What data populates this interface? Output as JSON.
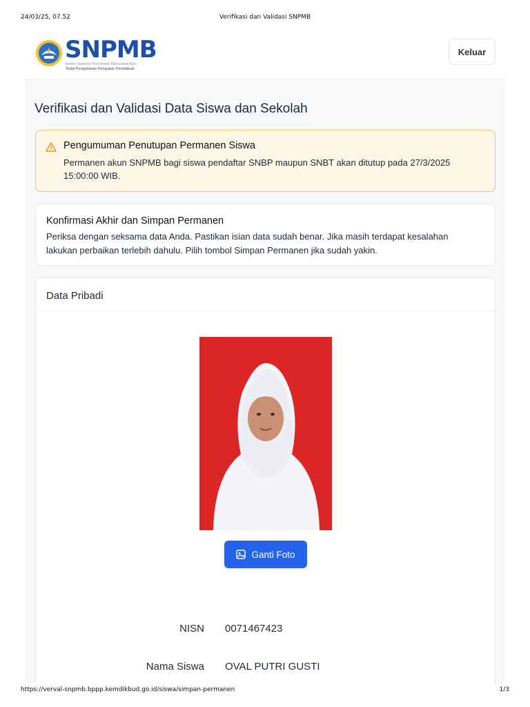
{
  "print_header": {
    "datetime": "24/03/25, 07.52",
    "page_title": "Verifikasi dan Validasi SNPMB"
  },
  "print_footer": {
    "url": "https://verval-snpmb.bppp.kemdikbud.go.id/siswa/simpan-permanen",
    "page": "1/3"
  },
  "header": {
    "logo_text": "SNPMB",
    "logo_subtitle": "Seleksi Nasional Penerimaan Mahasiswa Baru",
    "logo_org": "Balai Pengelolaan Pengujian Pendidikan",
    "logout_label": "Keluar"
  },
  "main": {
    "title": "Verifikasi dan Validasi Data Siswa dan Sekolah",
    "alert": {
      "icon": "warning-triangle-icon",
      "title": "Pengumuman Penutupan Permanen Siswa",
      "body": "Permanen akun SNPMB bagi siswa pendaftar SNBP maupun SNBT akan ditutup pada 27/3/2025 15:00:00 WIB."
    },
    "confirm": {
      "title": "Konfirmasi Akhir dan Simpan Permanen",
      "body": "Periksa dengan seksama data Anda. Pastikan isian data sudah benar. Jika masih terdapat kesalahan lakukan perbaikan terlebih dahulu. Pilih tombol Simpan Permanen jika sudah yakin."
    },
    "personal": {
      "title": "Data Pribadi",
      "change_photo_label": "Ganti Foto",
      "fields": [
        {
          "label": "NISN",
          "value": "0071467423"
        },
        {
          "label": "Nama Siswa",
          "value": "OVAL PUTRI GUSTI"
        }
      ]
    }
  },
  "colors": {
    "primary": "#2563eb",
    "alert_bg": "#fdf6e7",
    "alert_border": "#f0c76a",
    "photo_bg": "#dc2626",
    "brand": "#1e4fa8"
  }
}
